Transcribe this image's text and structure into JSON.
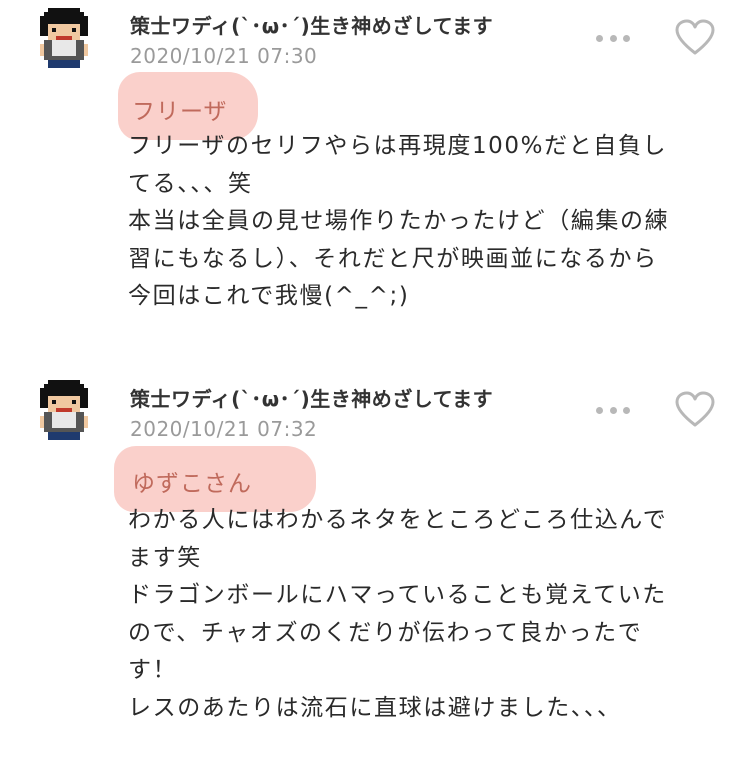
{
  "comments": [
    {
      "username": "策士ワディ(`･ω･´)生き神めざしてます",
      "timestamp": "2020/10/21 07:30",
      "mention": "フリーザ",
      "lines": [
        "フリーザのセリフやらは再現度100%だと自負し",
        "てる、、、笑",
        "本当は全員の見せ場作りたかったけど（編集の練",
        "習にもなるし）、それだと尺が映画並になるから",
        "今回はこれで我慢(^_^;)"
      ]
    },
    {
      "username": "策士ワディ(`･ω･´)生き神めざしてます",
      "timestamp": "2020/10/21 07:32",
      "mention": "ゆずこさん",
      "lines": [
        "わかる人にはわかるネタをところどころ仕込んで",
        "ます笑",
        "ドラゴンボールにハマっていることも覚えていた",
        "ので、チャオズのくだりが伝わって良かったで",
        "す！",
        "レスのあたりは流石に直球は避けました、、、"
      ]
    }
  ],
  "icons": {
    "more": "more-dots-icon",
    "like": "heart-outline-icon",
    "avatar": "pixel-avatar"
  },
  "colors": {
    "highlight": "#f5aaa0",
    "timestamp": "#9a9a9a",
    "icon": "#b8b8b8"
  }
}
